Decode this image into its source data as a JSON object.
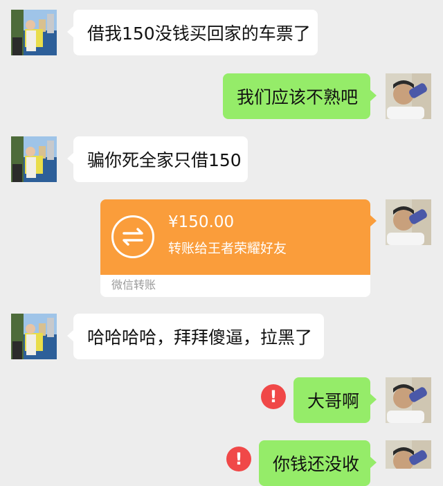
{
  "messages": [
    {
      "text": "借我150没钱买回家的车票了"
    },
    {
      "text": "我们应该不熟吧"
    },
    {
      "text": "骗你死全家只借150"
    },
    {
      "text": "哈哈哈哈，拜拜傻逼，拉黑了"
    },
    {
      "text": "大哥啊"
    },
    {
      "text": "你钱还没收"
    }
  ],
  "transfer": {
    "amount": "¥150.00",
    "note": "转账给王者荣耀好友",
    "footer": "微信转账"
  },
  "alert_symbol": "!",
  "colors": {
    "background": "#ededed",
    "incoming_bubble": "#ffffff",
    "outgoing_bubble": "#95ec69",
    "transfer": "#fa9d3b",
    "alert": "#f04848"
  }
}
